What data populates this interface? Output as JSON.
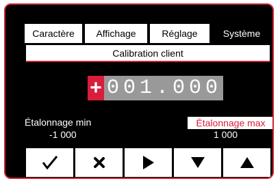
{
  "tabs": [
    "Caractère",
    "Affichage",
    "Réglage",
    "Système"
  ],
  "active_tab": "Système",
  "subtitle": "Calibration client",
  "value": {
    "sign": "+",
    "digits": "001.000"
  },
  "min": {
    "label": "Étalonnage min",
    "value": "-1 000"
  },
  "max": {
    "label": "Étalonnage max",
    "value": "1 000"
  },
  "buttons": [
    "check-icon",
    "cross-icon",
    "arrow-right-icon",
    "arrow-down-icon",
    "arrow-up-icon"
  ],
  "colors": {
    "accent": "#d81e3c",
    "border": "#cc2233",
    "background": "#000000",
    "digits_bg": "#999999"
  }
}
